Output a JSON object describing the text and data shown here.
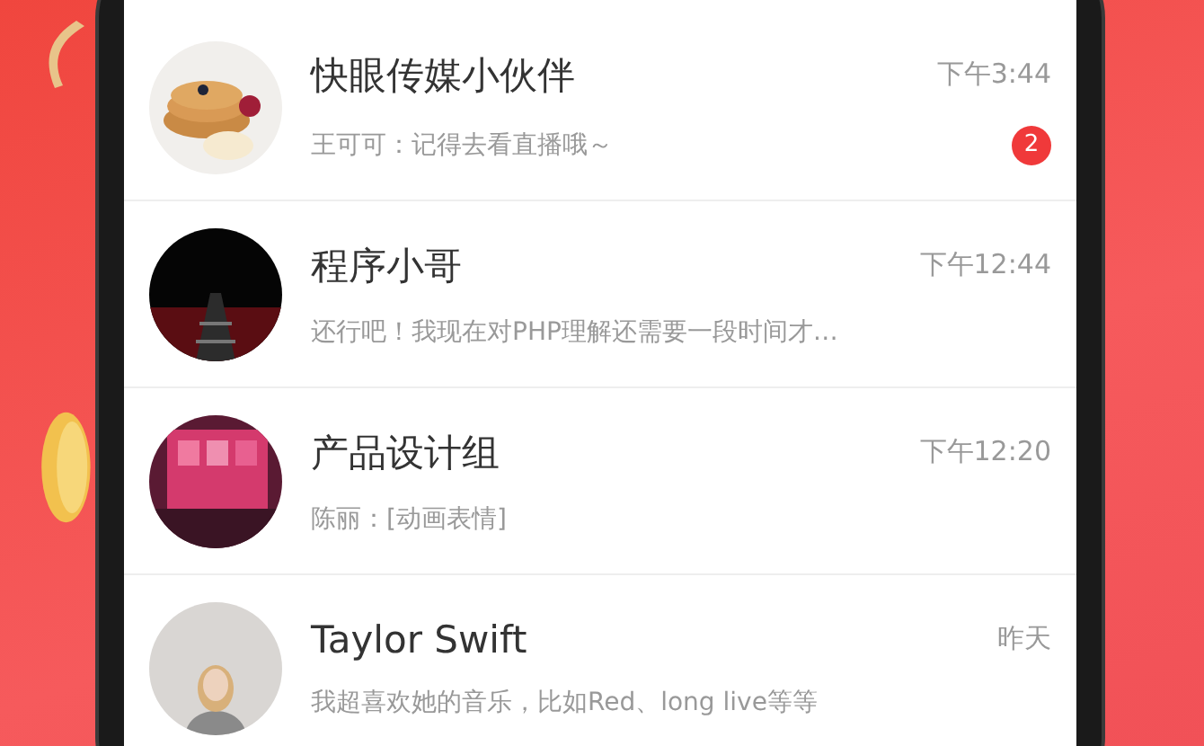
{
  "chats": [
    {
      "name": "快眼传媒小伙伴",
      "time": "下午3:44",
      "preview": "王可可：记得去看直播哦～",
      "badge": "2"
    },
    {
      "name": "程序小哥",
      "time": "下午12:44",
      "preview": "还行吧！我现在对PHP理解还需要一段时间才…"
    },
    {
      "name": "产品设计组",
      "time": "下午12:20",
      "preview": "陈丽：[动画表情]"
    },
    {
      "name": "Taylor Swift",
      "time": "昨天",
      "preview": "我超喜欢她的音乐，比如Red、long live等等"
    }
  ]
}
